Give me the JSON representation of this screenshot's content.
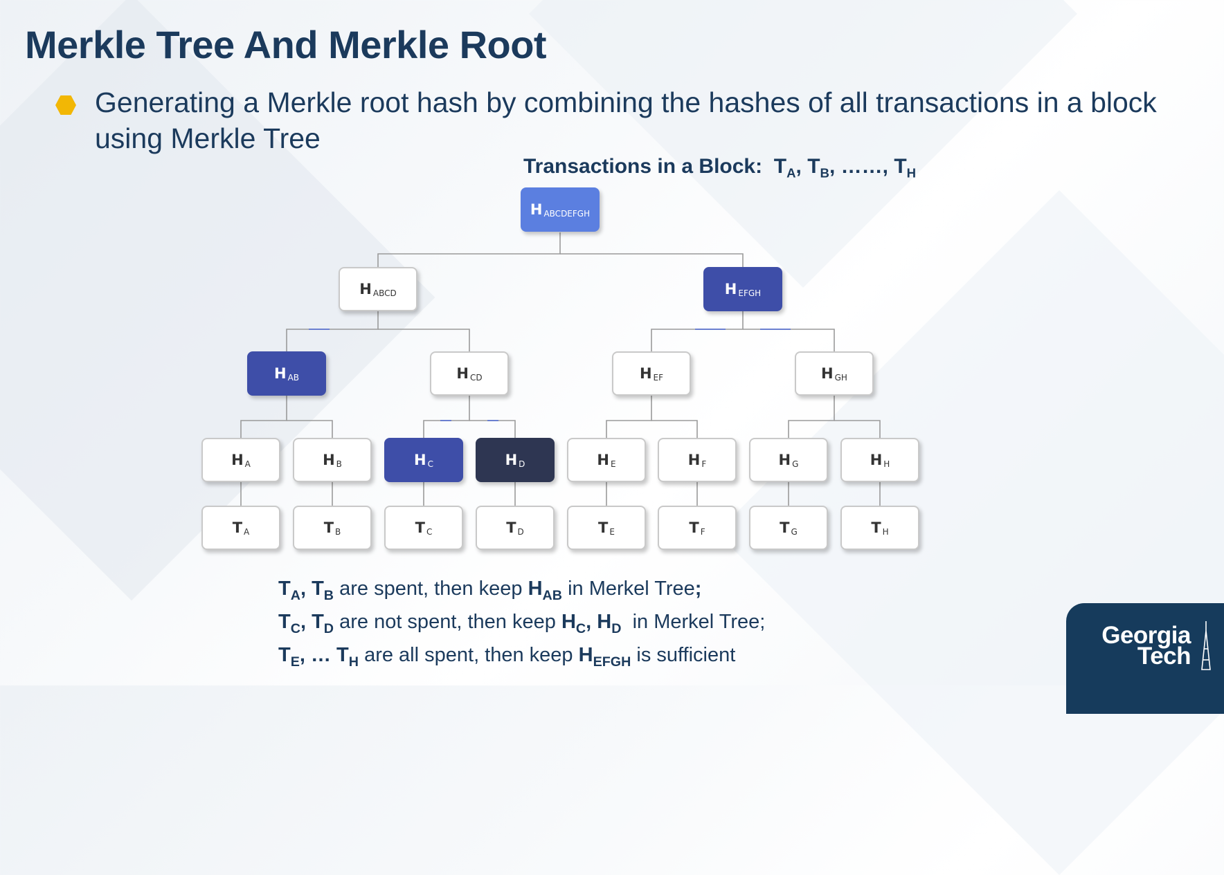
{
  "slide": {
    "title": "Merkle Tree And Merkle Root",
    "bullet": "Generating a Merkle root hash by combining the hashes of all transactions in a block using Merkle Tree"
  },
  "colors": {
    "title_text": "#1b3a5c",
    "bullet_marker": "#f2b705",
    "root_node": "#5b7fe0",
    "kept_node": "#3e4ea8",
    "proof_node": "#2e3652",
    "logo_background": "#163b5c"
  },
  "transactions_heading": {
    "prefix": "Transactions in a Block:",
    "t_a": "A",
    "t_b": "B",
    "ellipsis": "……",
    "t_h": "H"
  },
  "tree": {
    "root": {
      "letter": "H",
      "sub": "ABCDEFGH"
    },
    "level1": [
      {
        "letter": "H",
        "sub": "ABCD"
      },
      {
        "letter": "H",
        "sub": "EFGH"
      }
    ],
    "level2": [
      {
        "letter": "H",
        "sub": "AB"
      },
      {
        "letter": "H",
        "sub": "CD"
      },
      {
        "letter": "H",
        "sub": "EF"
      },
      {
        "letter": "H",
        "sub": "GH"
      }
    ],
    "leaves": [
      {
        "letter": "H",
        "sub": "A"
      },
      {
        "letter": "H",
        "sub": "B"
      },
      {
        "letter": "H",
        "sub": "C"
      },
      {
        "letter": "H",
        "sub": "D"
      },
      {
        "letter": "H",
        "sub": "E"
      },
      {
        "letter": "H",
        "sub": "F"
      },
      {
        "letter": "H",
        "sub": "G"
      },
      {
        "letter": "H",
        "sub": "H"
      }
    ],
    "transactions": [
      {
        "letter": "T",
        "sub": "A"
      },
      {
        "letter": "T",
        "sub": "B"
      },
      {
        "letter": "T",
        "sub": "C"
      },
      {
        "letter": "T",
        "sub": "D"
      },
      {
        "letter": "T",
        "sub": "E"
      },
      {
        "letter": "T",
        "sub": "F"
      },
      {
        "letter": "T",
        "sub": "G"
      },
      {
        "letter": "T",
        "sub": "H"
      }
    ]
  },
  "notes": {
    "line1_mid": "are spent, then keep",
    "line1_end": "in Merkel Tree",
    "line1_semicolon": ";",
    "line2_mid": "are not spent, then keep",
    "line2_end": "in Merkel Tree;",
    "line3_dots": "…",
    "line3_mid": "are all spent, then keep",
    "line3_end": "is sufficient"
  },
  "logo": {
    "line1": "Georgia",
    "line2": "Tech"
  }
}
